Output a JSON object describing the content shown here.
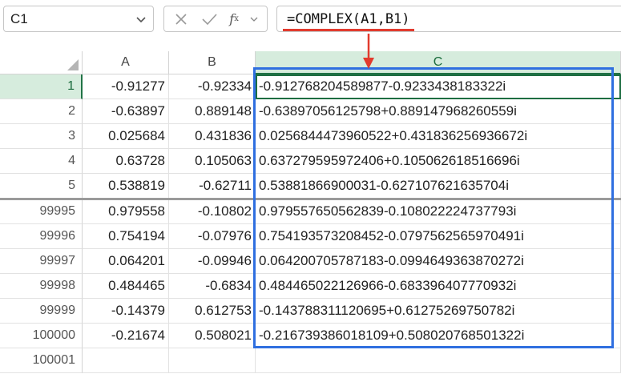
{
  "name_box": {
    "value": "C1"
  },
  "formula_bar": {
    "formula": "=COMPLEX(A1,B1)",
    "fx_label": "fx"
  },
  "columns": [
    "A",
    "B",
    "C"
  ],
  "rows": [
    {
      "row": "1",
      "a": "-0.91277",
      "b": "-0.92334",
      "c": "-0.912768204589877-0.9233438183322i"
    },
    {
      "row": "2",
      "a": "-0.63897",
      "b": "0.889148",
      "c": "-0.63897056125798+0.889147968260559i"
    },
    {
      "row": "3",
      "a": "0.025684",
      "b": "0.431836",
      "c": "0.0256844473960522+0.431836256936672i"
    },
    {
      "row": "4",
      "a": "0.63728",
      "b": "0.105063",
      "c": "0.637279595972406+0.105062618516696i"
    },
    {
      "row": "5",
      "a": "0.538819",
      "b": "-0.62711",
      "c": "0.53881866900031-0.627107621635704i"
    },
    {
      "row": "99995",
      "a": "0.979558",
      "b": "-0.10802",
      "c": "0.979557650562839-0.108022224737793i"
    },
    {
      "row": "99996",
      "a": "0.754194",
      "b": "-0.07976",
      "c": "0.754193573208452-0.0797562565970491i"
    },
    {
      "row": "99997",
      "a": "0.064201",
      "b": "-0.09946",
      "c": "0.064200705787183-0.0994649363870272i"
    },
    {
      "row": "99998",
      "a": "0.484465",
      "b": "-0.6834",
      "c": "0.484465022126966-0.683396407770932i"
    },
    {
      "row": "99999",
      "a": "-0.14379",
      "b": "0.612753",
      "c": "-0.143788311120695+0.61275269750782i"
    },
    {
      "row": "100000",
      "a": "-0.21674",
      "b": "0.508021",
      "c": "-0.216739386018109+0.508020768501322i"
    },
    {
      "row": "100001",
      "a": "",
      "b": "",
      "c": ""
    }
  ],
  "icons": {
    "namebox_dropdown": "chevron-down-icon",
    "cancel": "close-icon",
    "enter": "check-icon",
    "insert_function": "fx-icon"
  },
  "colors": {
    "selection_green": "#217346",
    "highlight_blue": "#2f6fe0",
    "annotation_red": "#e23b2e"
  }
}
